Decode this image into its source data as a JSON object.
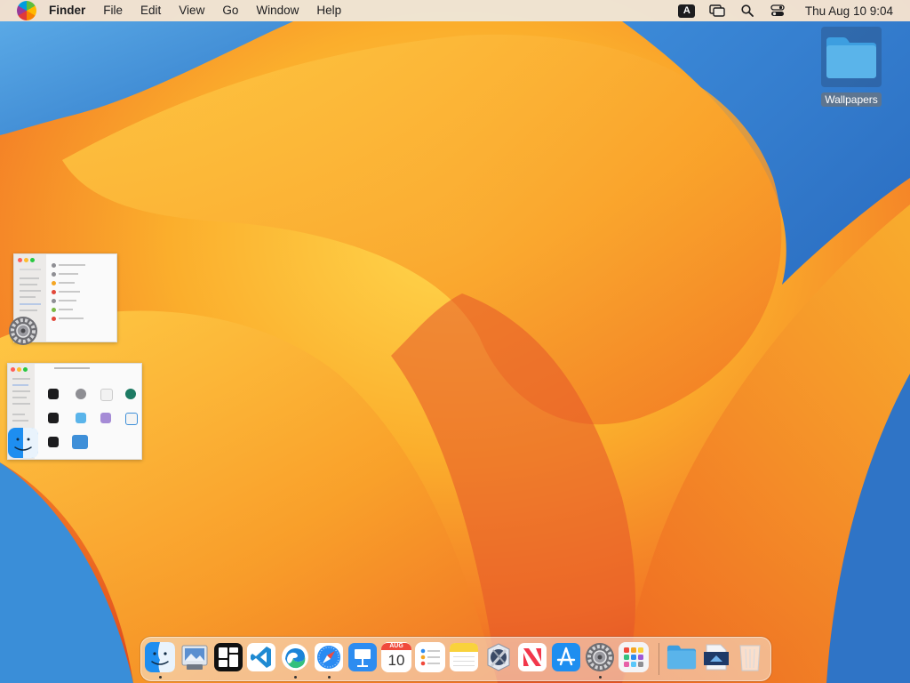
{
  "menubar": {
    "app_name": "Finder",
    "menus": [
      "File",
      "Edit",
      "View",
      "Go",
      "Window",
      "Help"
    ],
    "input_source": "A",
    "clock": "Thu Aug 10  9:04"
  },
  "desktop": {
    "folder_label": "Wallpapers"
  },
  "minimized_windows": [
    {
      "app": "System Settings",
      "icon": "gear-icon"
    },
    {
      "app": "Finder",
      "icon": "finder-icon"
    }
  ],
  "dock": {
    "calendar_month": "AUG",
    "calendar_day": "10",
    "items": [
      {
        "name": "Finder",
        "icon": "finder-icon",
        "running": true
      },
      {
        "name": "Preview",
        "icon": "preview-icon",
        "running": false
      },
      {
        "name": "Tiles",
        "icon": "tiles-icon",
        "running": false
      },
      {
        "name": "Visual Studio Code",
        "icon": "vscode-icon",
        "running": false
      },
      {
        "name": "Microsoft Edge",
        "icon": "edge-icon",
        "running": true
      },
      {
        "name": "Safari",
        "icon": "safari-icon",
        "running": true
      },
      {
        "name": "Keynote",
        "icon": "keynote-icon",
        "running": false
      },
      {
        "name": "Calendar",
        "icon": "calendar-icon",
        "running": false
      },
      {
        "name": "Reminders",
        "icon": "reminders-icon",
        "running": false
      },
      {
        "name": "Notes",
        "icon": "notes-icon",
        "running": false
      },
      {
        "name": "Xcode Utility",
        "icon": "xcode-icon",
        "running": false
      },
      {
        "name": "News",
        "icon": "news-icon",
        "running": false
      },
      {
        "name": "App Store",
        "icon": "app-store-icon",
        "running": false
      },
      {
        "name": "System Settings",
        "icon": "gear-icon",
        "running": true
      },
      {
        "name": "Launchpad",
        "icon": "launchpad-icon",
        "running": false
      },
      {
        "name": "Folder",
        "icon": "folder-icon",
        "running": false
      },
      {
        "name": "Screen Share",
        "icon": "document-icon",
        "running": false
      },
      {
        "name": "Trash",
        "icon": "trash-icon",
        "running": false
      }
    ]
  },
  "colors": {
    "menubar_bg": "#eee8de",
    "folder_blue": "#5ab4ea",
    "wallpaper_orange": "#f4862a",
    "wallpaper_yellow": "#ffd24a",
    "wallpaper_blue": "#3a8ed8"
  }
}
